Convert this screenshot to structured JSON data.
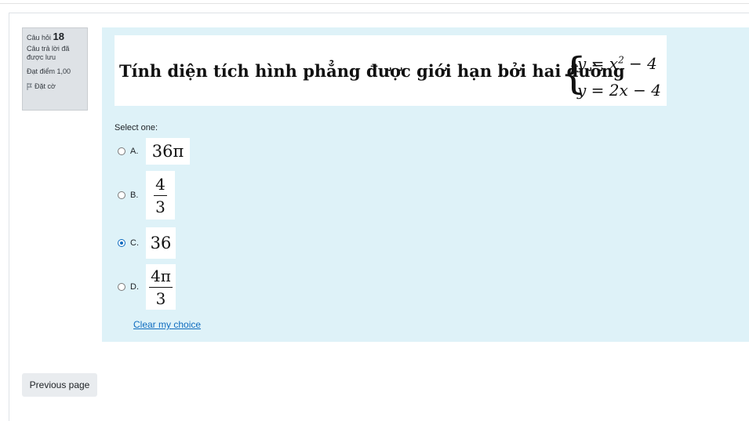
{
  "question_info": {
    "label": "Câu hỏi",
    "number": "18",
    "state": "Câu trả lời đã được lưu",
    "grade": "Đạt điểm 1,00",
    "flag_label": "Đặt cờ"
  },
  "question": {
    "text": "Tính diện tích hình phẳng được giới hạn bởi hai đường",
    "eq1": "y = x",
    "eq1_exp": "2",
    "eq1_tail": " − 4",
    "eq2": "y = 2x − 4"
  },
  "prompt": "Select one:",
  "options": [
    {
      "letter": "A.",
      "value": "36π",
      "selected": false
    },
    {
      "letter": "B.",
      "numerator": "4",
      "denominator": "3",
      "selected": false
    },
    {
      "letter": "C.",
      "value": "36",
      "selected": true
    },
    {
      "letter": "D.",
      "numerator": "4π",
      "denominator": "3",
      "selected": false
    }
  ],
  "clear_label": "Clear my choice",
  "nav": {
    "previous_label": "Previous page"
  },
  "colors": {
    "formulation_bg": "#def2f8",
    "info_bg": "#dee2e6",
    "link": "#0f6cbf"
  }
}
